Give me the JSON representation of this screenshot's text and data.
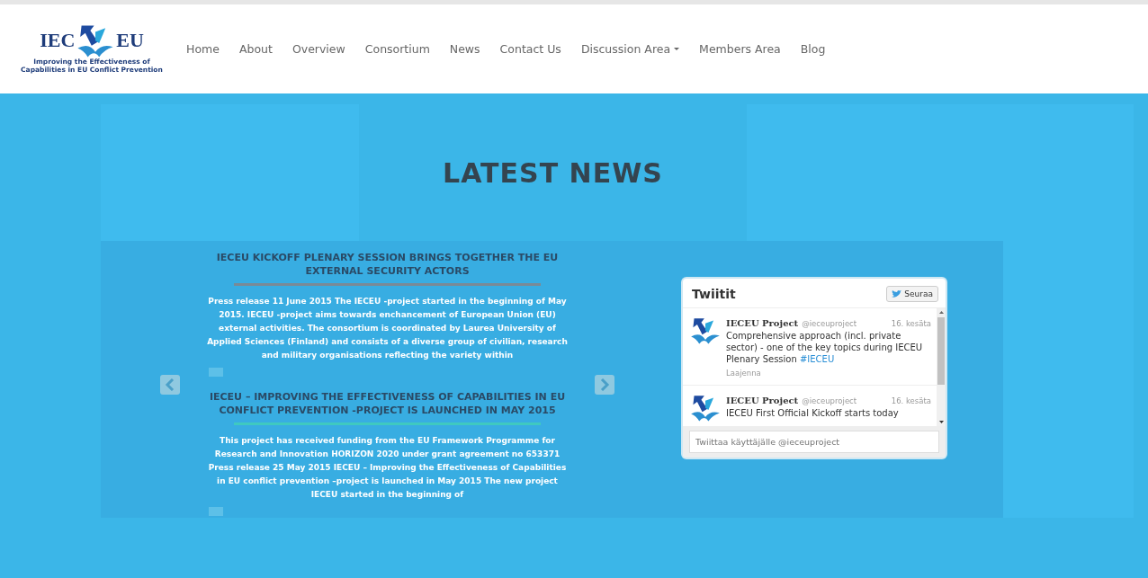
{
  "logo": {
    "left": "IEC",
    "right": "EU",
    "tagline": "Improving the Effectiveness of Capabilities in EU Conflict Prevention"
  },
  "nav": [
    {
      "label": "Home",
      "dropdown": false
    },
    {
      "label": "About",
      "dropdown": false
    },
    {
      "label": "Overview",
      "dropdown": false
    },
    {
      "label": "Consortium",
      "dropdown": false
    },
    {
      "label": "News",
      "dropdown": false
    },
    {
      "label": "Contact Us",
      "dropdown": false
    },
    {
      "label": "Discussion Area",
      "dropdown": true
    },
    {
      "label": "Members Area",
      "dropdown": false
    },
    {
      "label": "Blog",
      "dropdown": false
    }
  ],
  "heading": "LATEST NEWS",
  "news": [
    {
      "title": "IECEU KICKOFF PLENARY SESSION BRINGS TOGETHER THE EU EXTERNAL SECURITY ACTORS",
      "color": "#7a8a96",
      "body": "Press release 11 June 2015    The IECEU -project started in the beginning of May 2015. IECEU -project aims towards enchancement of European Union (EU) external activities. The consortium is coordinated by Laurea University of Applied Sciences (Finland) and consists of a diverse group of civilian, research and military organisations reflecting the variety within"
    },
    {
      "title": "IECEU – IMPROVING THE EFFECTIVENESS OF CAPABILITIES IN EU CONFLICT PREVENTION -PROJECT IS LAUNCHED IN MAY 2015",
      "color": "#3fc9c0",
      "body": "This project has received funding from the EU Framework Programme for Research and Innovation HORIZON 2020 under grant agreement no 653371 Press release 25 May 2015   IECEU – Improving the Effectiveness of Capabilities in EU conflict prevention –project is launched in May 2015   The new project IECEU started in the beginning of"
    }
  ],
  "twitter": {
    "title": "Twiitit",
    "follow": "Seuraa",
    "placeholder": "Twiittaa käyttäjälle @ieceuproject",
    "tweets": [
      {
        "name": "IECEU Project",
        "handle": "@ieceuproject",
        "date": "16. kesäta",
        "text": "Comprehensive approach (incl. private sector) - one of the key topics during IECEU Plenary Session ",
        "hashtag": "#IECEU",
        "expand": "Laajenna"
      },
      {
        "name": "IECEU Project",
        "handle": "@ieceuproject",
        "date": "16. kesäta",
        "text": "IECEU First Official Kickoff starts today"
      }
    ]
  }
}
